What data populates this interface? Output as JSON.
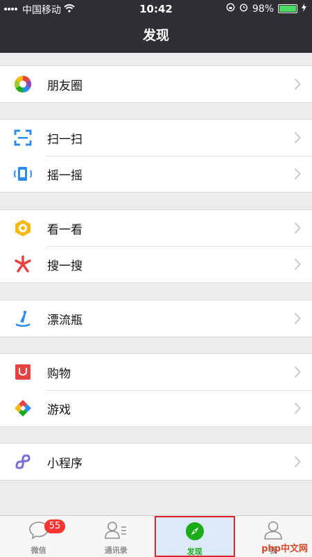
{
  "status_bar": {
    "carrier": "中国移动",
    "time": "10:42",
    "battery": "98%"
  },
  "nav": {
    "title": "发现"
  },
  "groups": [
    {
      "items": [
        {
          "label": "朋友圈",
          "icon": "moments-icon"
        }
      ]
    },
    {
      "items": [
        {
          "label": "扫一扫",
          "icon": "scan-icon"
        },
        {
          "label": "摇一摇",
          "icon": "shake-icon"
        }
      ]
    },
    {
      "items": [
        {
          "label": "看一看",
          "icon": "top-stories-icon"
        },
        {
          "label": "搜一搜",
          "icon": "search-icon"
        }
      ]
    },
    {
      "items": [
        {
          "label": "漂流瓶",
          "icon": "bottle-icon"
        }
      ]
    },
    {
      "items": [
        {
          "label": "购物",
          "icon": "shopping-icon"
        },
        {
          "label": "游戏",
          "icon": "games-icon"
        }
      ]
    },
    {
      "items": [
        {
          "label": "小程序",
          "icon": "mini-programs-icon"
        }
      ]
    }
  ],
  "tabs": [
    {
      "label": "微信",
      "icon": "chat-icon",
      "badge": "55"
    },
    {
      "label": "通讯录",
      "icon": "contacts-icon"
    },
    {
      "label": "发现",
      "icon": "compass-icon"
    },
    {
      "label": "我",
      "icon": "profile-icon"
    }
  ],
  "watermark": "php中文网",
  "colors": {
    "nav_bg": "#2e2e33",
    "accent_green": "#1aad19",
    "badge_red": "#f43530"
  }
}
